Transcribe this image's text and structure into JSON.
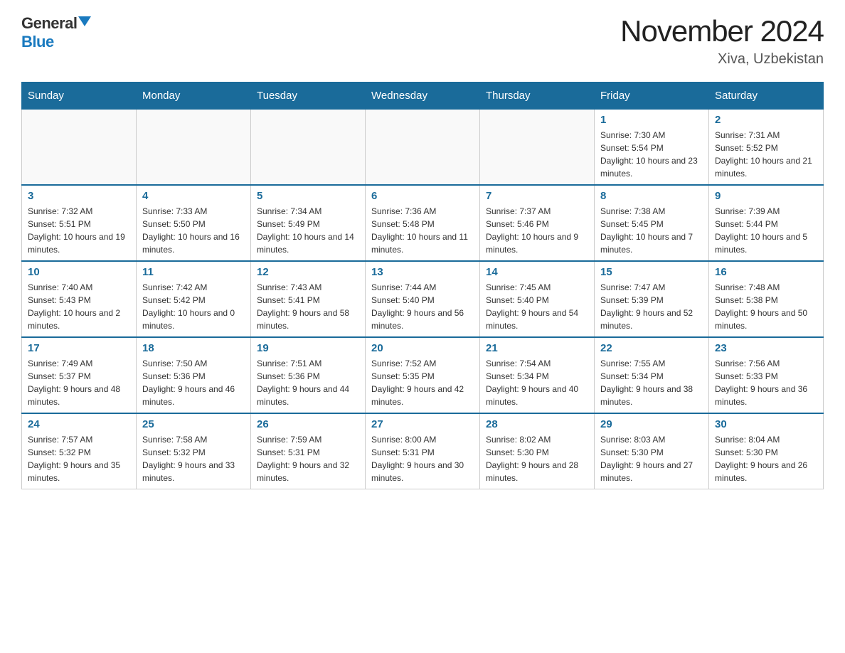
{
  "logo": {
    "general_text": "General",
    "blue_text": "Blue"
  },
  "header": {
    "month_year": "November 2024",
    "location": "Xiva, Uzbekistan"
  },
  "weekdays": [
    "Sunday",
    "Monday",
    "Tuesday",
    "Wednesday",
    "Thursday",
    "Friday",
    "Saturday"
  ],
  "weeks": [
    [
      {
        "day": "",
        "sunrise": "",
        "sunset": "",
        "daylight": ""
      },
      {
        "day": "",
        "sunrise": "",
        "sunset": "",
        "daylight": ""
      },
      {
        "day": "",
        "sunrise": "",
        "sunset": "",
        "daylight": ""
      },
      {
        "day": "",
        "sunrise": "",
        "sunset": "",
        "daylight": ""
      },
      {
        "day": "",
        "sunrise": "",
        "sunset": "",
        "daylight": ""
      },
      {
        "day": "1",
        "sunrise": "Sunrise: 7:30 AM",
        "sunset": "Sunset: 5:54 PM",
        "daylight": "Daylight: 10 hours and 23 minutes."
      },
      {
        "day": "2",
        "sunrise": "Sunrise: 7:31 AM",
        "sunset": "Sunset: 5:52 PM",
        "daylight": "Daylight: 10 hours and 21 minutes."
      }
    ],
    [
      {
        "day": "3",
        "sunrise": "Sunrise: 7:32 AM",
        "sunset": "Sunset: 5:51 PM",
        "daylight": "Daylight: 10 hours and 19 minutes."
      },
      {
        "day": "4",
        "sunrise": "Sunrise: 7:33 AM",
        "sunset": "Sunset: 5:50 PM",
        "daylight": "Daylight: 10 hours and 16 minutes."
      },
      {
        "day": "5",
        "sunrise": "Sunrise: 7:34 AM",
        "sunset": "Sunset: 5:49 PM",
        "daylight": "Daylight: 10 hours and 14 minutes."
      },
      {
        "day": "6",
        "sunrise": "Sunrise: 7:36 AM",
        "sunset": "Sunset: 5:48 PM",
        "daylight": "Daylight: 10 hours and 11 minutes."
      },
      {
        "day": "7",
        "sunrise": "Sunrise: 7:37 AM",
        "sunset": "Sunset: 5:46 PM",
        "daylight": "Daylight: 10 hours and 9 minutes."
      },
      {
        "day": "8",
        "sunrise": "Sunrise: 7:38 AM",
        "sunset": "Sunset: 5:45 PM",
        "daylight": "Daylight: 10 hours and 7 minutes."
      },
      {
        "day": "9",
        "sunrise": "Sunrise: 7:39 AM",
        "sunset": "Sunset: 5:44 PM",
        "daylight": "Daylight: 10 hours and 5 minutes."
      }
    ],
    [
      {
        "day": "10",
        "sunrise": "Sunrise: 7:40 AM",
        "sunset": "Sunset: 5:43 PM",
        "daylight": "Daylight: 10 hours and 2 minutes."
      },
      {
        "day": "11",
        "sunrise": "Sunrise: 7:42 AM",
        "sunset": "Sunset: 5:42 PM",
        "daylight": "Daylight: 10 hours and 0 minutes."
      },
      {
        "day": "12",
        "sunrise": "Sunrise: 7:43 AM",
        "sunset": "Sunset: 5:41 PM",
        "daylight": "Daylight: 9 hours and 58 minutes."
      },
      {
        "day": "13",
        "sunrise": "Sunrise: 7:44 AM",
        "sunset": "Sunset: 5:40 PM",
        "daylight": "Daylight: 9 hours and 56 minutes."
      },
      {
        "day": "14",
        "sunrise": "Sunrise: 7:45 AM",
        "sunset": "Sunset: 5:40 PM",
        "daylight": "Daylight: 9 hours and 54 minutes."
      },
      {
        "day": "15",
        "sunrise": "Sunrise: 7:47 AM",
        "sunset": "Sunset: 5:39 PM",
        "daylight": "Daylight: 9 hours and 52 minutes."
      },
      {
        "day": "16",
        "sunrise": "Sunrise: 7:48 AM",
        "sunset": "Sunset: 5:38 PM",
        "daylight": "Daylight: 9 hours and 50 minutes."
      }
    ],
    [
      {
        "day": "17",
        "sunrise": "Sunrise: 7:49 AM",
        "sunset": "Sunset: 5:37 PM",
        "daylight": "Daylight: 9 hours and 48 minutes."
      },
      {
        "day": "18",
        "sunrise": "Sunrise: 7:50 AM",
        "sunset": "Sunset: 5:36 PM",
        "daylight": "Daylight: 9 hours and 46 minutes."
      },
      {
        "day": "19",
        "sunrise": "Sunrise: 7:51 AM",
        "sunset": "Sunset: 5:36 PM",
        "daylight": "Daylight: 9 hours and 44 minutes."
      },
      {
        "day": "20",
        "sunrise": "Sunrise: 7:52 AM",
        "sunset": "Sunset: 5:35 PM",
        "daylight": "Daylight: 9 hours and 42 minutes."
      },
      {
        "day": "21",
        "sunrise": "Sunrise: 7:54 AM",
        "sunset": "Sunset: 5:34 PM",
        "daylight": "Daylight: 9 hours and 40 minutes."
      },
      {
        "day": "22",
        "sunrise": "Sunrise: 7:55 AM",
        "sunset": "Sunset: 5:34 PM",
        "daylight": "Daylight: 9 hours and 38 minutes."
      },
      {
        "day": "23",
        "sunrise": "Sunrise: 7:56 AM",
        "sunset": "Sunset: 5:33 PM",
        "daylight": "Daylight: 9 hours and 36 minutes."
      }
    ],
    [
      {
        "day": "24",
        "sunrise": "Sunrise: 7:57 AM",
        "sunset": "Sunset: 5:32 PM",
        "daylight": "Daylight: 9 hours and 35 minutes."
      },
      {
        "day": "25",
        "sunrise": "Sunrise: 7:58 AM",
        "sunset": "Sunset: 5:32 PM",
        "daylight": "Daylight: 9 hours and 33 minutes."
      },
      {
        "day": "26",
        "sunrise": "Sunrise: 7:59 AM",
        "sunset": "Sunset: 5:31 PM",
        "daylight": "Daylight: 9 hours and 32 minutes."
      },
      {
        "day": "27",
        "sunrise": "Sunrise: 8:00 AM",
        "sunset": "Sunset: 5:31 PM",
        "daylight": "Daylight: 9 hours and 30 minutes."
      },
      {
        "day": "28",
        "sunrise": "Sunrise: 8:02 AM",
        "sunset": "Sunset: 5:30 PM",
        "daylight": "Daylight: 9 hours and 28 minutes."
      },
      {
        "day": "29",
        "sunrise": "Sunrise: 8:03 AM",
        "sunset": "Sunset: 5:30 PM",
        "daylight": "Daylight: 9 hours and 27 minutes."
      },
      {
        "day": "30",
        "sunrise": "Sunrise: 8:04 AM",
        "sunset": "Sunset: 5:30 PM",
        "daylight": "Daylight: 9 hours and 26 minutes."
      }
    ]
  ]
}
